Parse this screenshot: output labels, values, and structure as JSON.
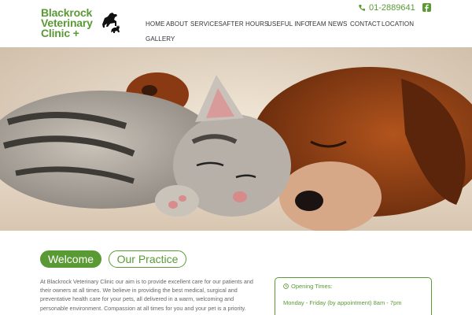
{
  "logo": {
    "lines": [
      "Blackrock",
      "Veterinary",
      "Clinic +"
    ]
  },
  "contact": {
    "phone": "01-2889641"
  },
  "nav": {
    "items": [
      "HOME",
      "ABOUT",
      "SERVICES",
      "AFTER HOURS",
      "USEFUL INFO",
      "TEAM",
      "NEWS",
      "CONTACT",
      "LOCATION",
      "GALLERY"
    ]
  },
  "tabs": {
    "welcome": "Welcome",
    "practice": "Our Practice"
  },
  "intro": "At Blackrock Veterinary Clinic our aim is to provide excellent care for our patients and their owners at all times. We believe in providing the best medical, surgical and preventative health care for your pets, all delivered in a warm, welcoming and personable environment. Compassion at all times for you and your pet is a priority.",
  "hours": {
    "title": "Opening Times:",
    "line1": "Monday - Friday (by appointment) 8am - 7pm"
  },
  "colors": {
    "accent": "#5a9a35",
    "nav_text": "#333333",
    "body_text": "#666666"
  },
  "icons": [
    "dog-cat-logo-icon",
    "phone-icon",
    "facebook-icon",
    "clock-icon"
  ]
}
